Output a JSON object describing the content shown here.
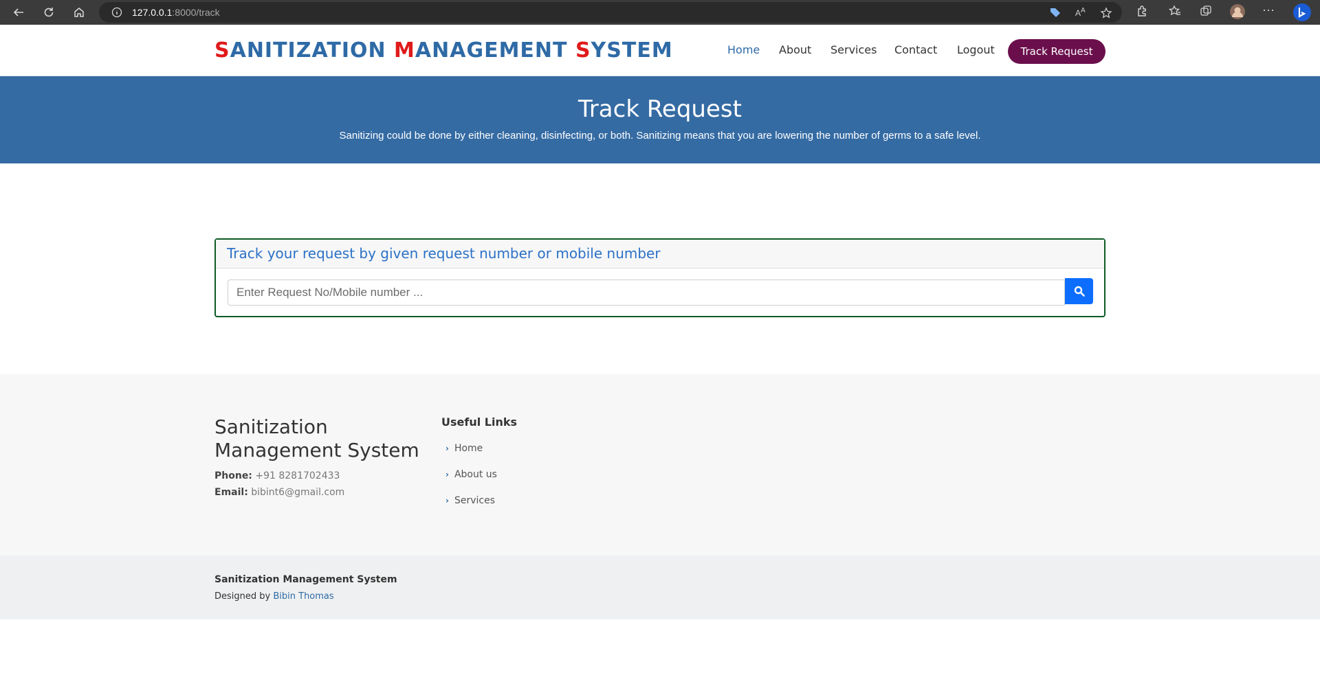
{
  "browser": {
    "url_host": "127.0.0.1",
    "url_rest": ":8000/track"
  },
  "header": {
    "logo_parts": [
      "S",
      "ANITIZATION ",
      "M",
      "ANAGEMENT ",
      "S",
      "YSTEM"
    ],
    "nav": [
      "Home",
      "About",
      "Services",
      "Contact",
      "Logout"
    ],
    "cta_label": "Track Request"
  },
  "hero": {
    "title": "Track Request",
    "subtitle": "Sanitizing could be done by either cleaning, disinfecting, or both. Sanitizing means that you are lowering the number of germs to a safe level."
  },
  "track": {
    "heading": "Track your request by given request number or mobile number",
    "placeholder": "Enter Request No/Mobile number ..."
  },
  "footer": {
    "title_line1": "Sanitization",
    "title_line2": "Management System",
    "phone_label": "Phone:",
    "phone": "+91 8281702433",
    "email_label": "Email:",
    "email": "bibint6@gmail.com",
    "links_title": "Useful Links",
    "links": [
      "Home",
      "About us",
      "Services"
    ]
  },
  "copyright": {
    "name": "Sanitization Management System",
    "designed_by": "Designed by",
    "author": "Bibin Thomas"
  },
  "colors": {
    "brand_blue": "#356ba3",
    "logo_red": "#e01a1a",
    "cta_purple": "#6b0f4c",
    "search_blue": "#0d6efd",
    "card_border": "#0c5a25"
  }
}
